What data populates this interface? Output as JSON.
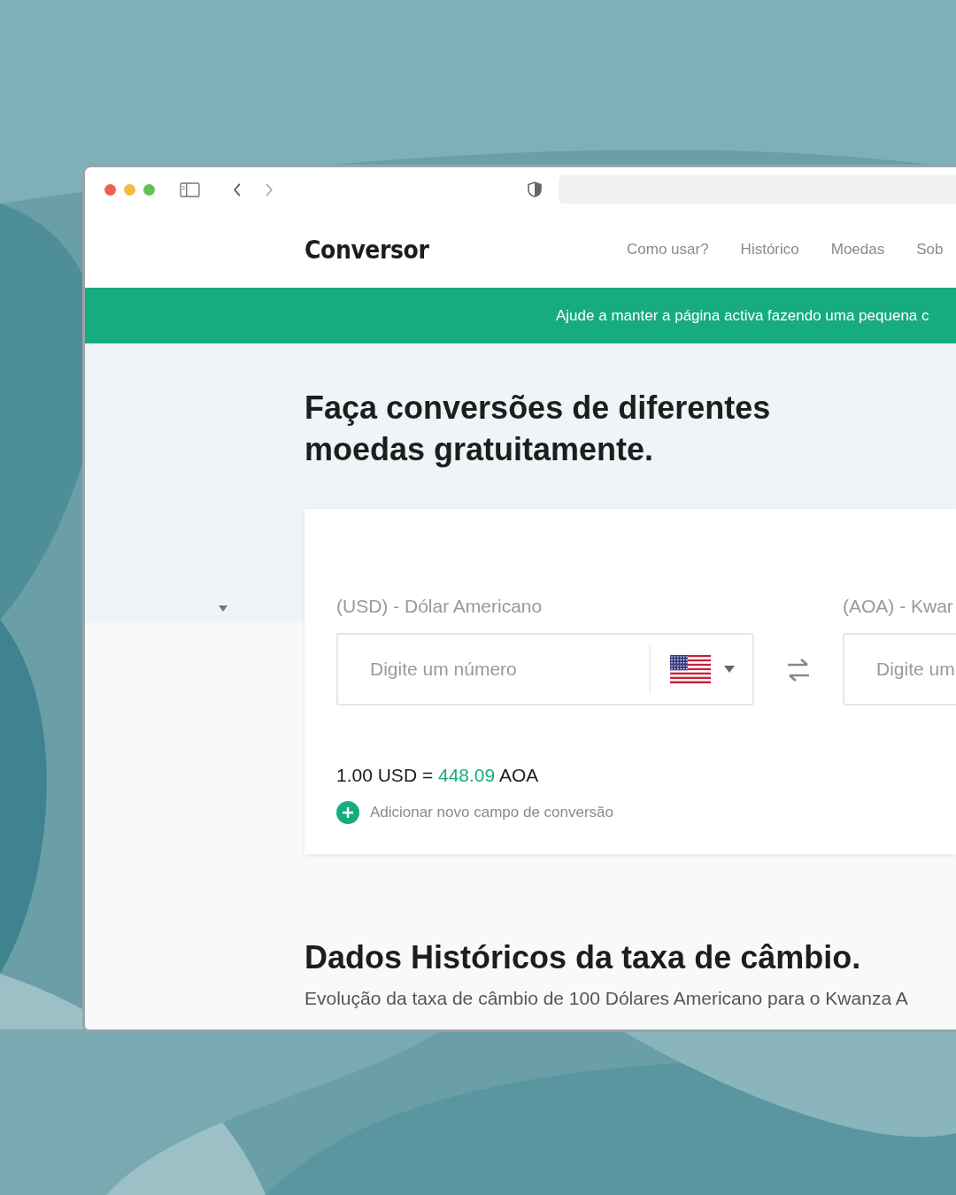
{
  "nav": {
    "logo": "Conversor",
    "links": [
      "Como usar?",
      "Histórico",
      "Moedas",
      "Sob"
    ]
  },
  "banner": {
    "text": "Ajude a manter a página activa fazendo uma pequena c"
  },
  "hero": {
    "title": "Faça conversões de diferentes moedas gratuitamente."
  },
  "converter": {
    "fields": [
      {
        "label": "(USD) - Dólar Americano",
        "placeholder": "Digite um número",
        "kind": "with-flag"
      },
      {
        "label": "(AOA) - Kwar",
        "placeholder": "Digite um",
        "kind": "plain"
      }
    ],
    "rate": {
      "base": "1.00 USD =",
      "value": "448.09",
      "quote": "AOA"
    },
    "add_link": "Adicionar novo campo de conversão"
  },
  "history": {
    "title": "Dados Históricos da taxa de câmbio.",
    "description": "Evolução da taxa de câmbio de 100 Dólares Americano para o Kwanza A"
  }
}
